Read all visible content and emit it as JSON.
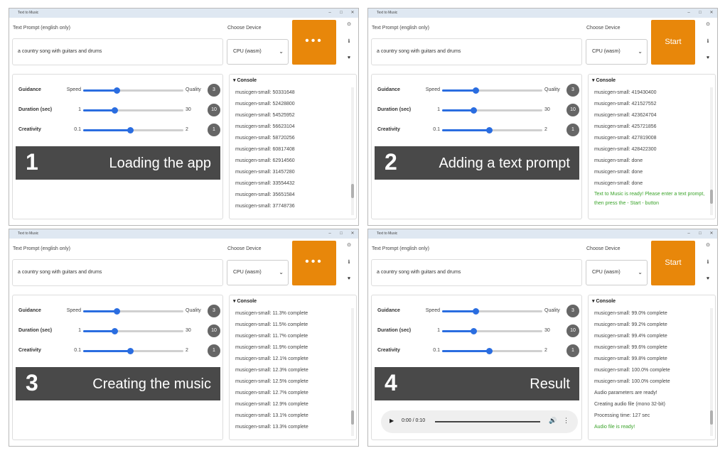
{
  "window_title": "Text to Music",
  "labels": {
    "prompt": "Text Prompt (english only)",
    "device": "Choose Device",
    "guidance": "Guidance",
    "duration": "Duration (sec)",
    "creativity": "Creativity",
    "console": "▾ Console"
  },
  "prompt_value": "a country song with guitars and drums",
  "device_value": "CPU (wasm)",
  "start_label": "Start",
  "sliders": {
    "guidance": {
      "min": "Speed",
      "max": "Quality",
      "value": "3",
      "level": 0.33
    },
    "duration": {
      "min": "1",
      "max": "30",
      "value": "10",
      "level": 0.31
    },
    "creativity": {
      "min": "0.1",
      "max": "2",
      "value": "1",
      "level": 0.47
    }
  },
  "panels": [
    {
      "step": "1",
      "caption": "Loading the app",
      "button": "busy",
      "console": [
        "musicgen-small: 50331648",
        "musicgen-small: 52428800",
        "musicgen-small: 54525952",
        "musicgen-small: 56623104",
        "musicgen-small: 58720256",
        "musicgen-small: 60817408",
        "musicgen-small: 62914560",
        "musicgen-small: 31457280",
        "musicgen-small: 33554432",
        "musicgen-small: 35651584",
        "musicgen-small: 37748736"
      ],
      "scroll": 0.85
    },
    {
      "step": "2",
      "caption": "Adding a text prompt",
      "button": "start",
      "console": [
        "musicgen-small: 419430400",
        "musicgen-small: 421527552",
        "musicgen-small: 423624704",
        "musicgen-small: 425721856",
        "musicgen-small: 427819008",
        "musicgen-small: 428422300",
        "musicgen-small: done",
        "musicgen-small: done",
        "musicgen-small: done"
      ],
      "ready": "Text to Music is ready! Please enter a text prompt, then press the - Start - button",
      "scroll": 0.9
    },
    {
      "step": "3",
      "caption": "Creating the music",
      "button": "busy",
      "console": [
        "musicgen-small: 11.3% complete",
        "musicgen-small: 11.5% complete",
        "musicgen-small: 11.7% complete",
        "musicgen-small: 11.9% complete",
        "musicgen-small: 12.1% complete",
        "musicgen-small: 12.3% complete",
        "musicgen-small: 12.5% complete",
        "musicgen-small: 12.7% complete",
        "musicgen-small: 12.9% complete",
        "musicgen-small: 13.1% complete",
        "musicgen-small: 13.3% complete"
      ],
      "scroll": 0.9
    },
    {
      "step": "4",
      "caption": "Result",
      "button": "start",
      "console": [
        "musicgen-small: 99.0% complete",
        "musicgen-small: 99.2% complete",
        "musicgen-small: 99.4% complete",
        "musicgen-small: 99.6% complete",
        "musicgen-small: 99.8% complete",
        "musicgen-small: 100.0% complete",
        "musicgen-small: 100.0% complete",
        "Audio parameters are ready!",
        "Creating audio file (mono 32-bit)",
        "Processing time: 127 sec"
      ],
      "ready": "Audio file is ready!",
      "audio_time": "0:00 / 0:10",
      "scroll": 0.9
    }
  ],
  "colors": {
    "accent": "#e8870a",
    "slider": "#2a6de0",
    "banner": "#494949",
    "ready": "#3aa32a"
  },
  "side_icons": [
    "github-icon",
    "info-icon",
    "heart-icon"
  ]
}
